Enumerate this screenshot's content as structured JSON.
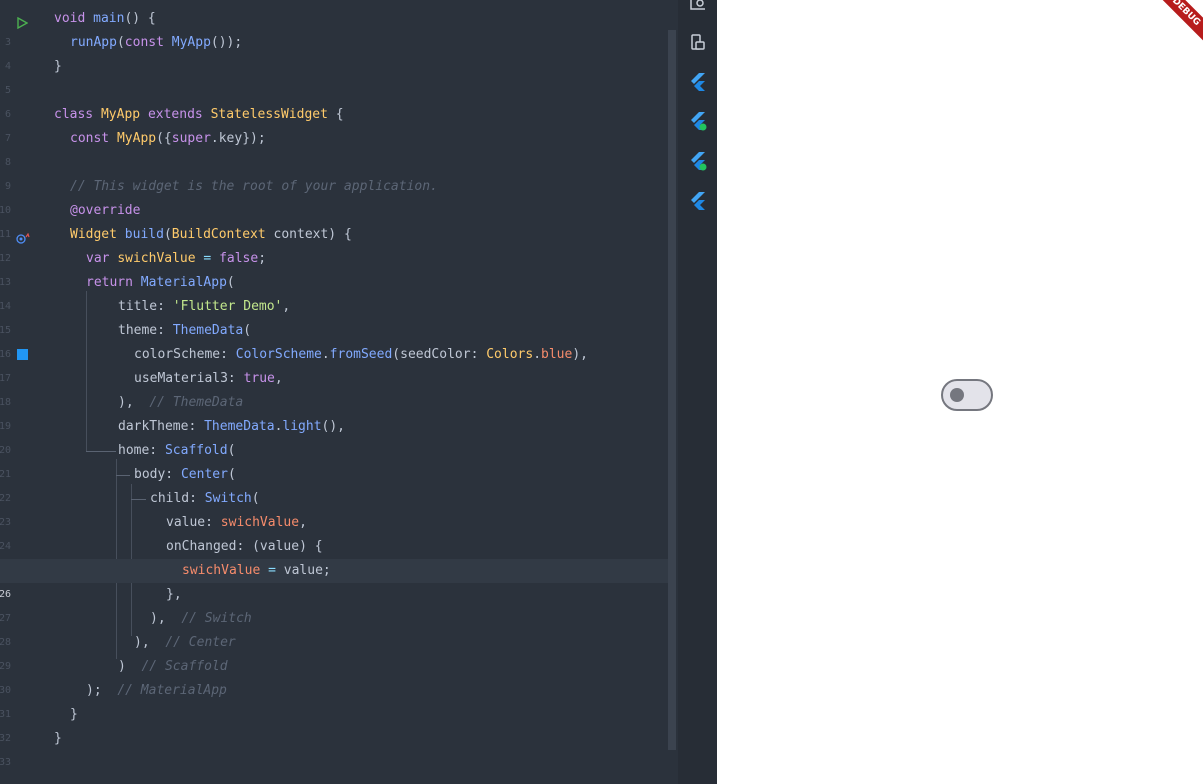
{
  "editor": {
    "line_numbers": [
      "3",
      "4",
      "5",
      "6",
      "7",
      "8",
      "9",
      "10",
      "11",
      "12",
      "13",
      "14",
      "15",
      "16",
      "17",
      "18",
      "19",
      "20",
      "21",
      "22",
      "23",
      "24",
      "25",
      "26",
      "27",
      "28",
      "29",
      "30",
      "31",
      "32",
      "33"
    ],
    "current_line": "26",
    "tokens": {
      "l3": [
        "void",
        "main",
        "() {"
      ],
      "l4": [
        "runApp",
        "(",
        "const",
        "MyApp",
        "());"
      ],
      "l5": [
        "}"
      ],
      "l7": [
        "class",
        "MyApp",
        "extends",
        "StatelessWidget",
        "{"
      ],
      "l8": [
        "const",
        "MyApp",
        "({",
        "super",
        ".key});"
      ],
      "l10": [
        "// This widget is the root of your application."
      ],
      "l11": [
        "@override"
      ],
      "l12": [
        "Widget",
        "build",
        "(",
        "BuildContext",
        "context) {"
      ],
      "l13": [
        "var",
        "swichValue",
        "=",
        "false",
        ";"
      ],
      "l14": [
        "return",
        "MaterialApp",
        "("
      ],
      "l15": [
        "title:",
        "'Flutter Demo'",
        ","
      ],
      "l16": [
        "theme:",
        "ThemeData",
        "("
      ],
      "l17": [
        "colorScheme:",
        "ColorScheme",
        ".",
        "fromSeed",
        "(seedColor:",
        "Colors",
        ".",
        "blue",
        "),"
      ],
      "l18": [
        "useMaterial3:",
        "true",
        ","
      ],
      "l19": [
        "),",
        "// ThemeData"
      ],
      "l20": [
        "darkTheme:",
        "ThemeData",
        ".",
        "light",
        "(),"
      ],
      "l21": [
        "home:",
        "Scaffold",
        "("
      ],
      "l22": [
        "body:",
        "Center",
        "("
      ],
      "l23": [
        "child:",
        "Switch",
        "("
      ],
      "l24": [
        "value:",
        "swichValue",
        ","
      ],
      "l25": [
        "onChanged:",
        "(value) {"
      ],
      "l26": [
        "swichValue",
        "=",
        "value;"
      ],
      "l27": [
        "},"
      ],
      "l28": [
        "),",
        "// Switch"
      ],
      "l29": [
        "),",
        "// Center"
      ],
      "l30": [
        ")",
        "// Scaffold"
      ],
      "l31": [
        ");",
        "// MaterialApp"
      ],
      "l32": [
        "}"
      ],
      "l33": [
        "}"
      ]
    }
  },
  "toolstrip": {
    "icons": [
      "widget-inspector-icon",
      "device-icon",
      "flutter-icon",
      "flutter-hot-reload-icon",
      "flutter-hot-restart-icon",
      "flutter-devtools-icon"
    ]
  },
  "preview": {
    "debug_banner": "DEBUG",
    "switch_value": false
  },
  "colors": {
    "editor_bg": "#2b323c",
    "keyword": "#c792ea",
    "class": "#ffcb6b",
    "function": "#82aaff",
    "string": "#c3e88d",
    "comment": "#5c6676",
    "flutter_blue": "#42a5f5"
  }
}
